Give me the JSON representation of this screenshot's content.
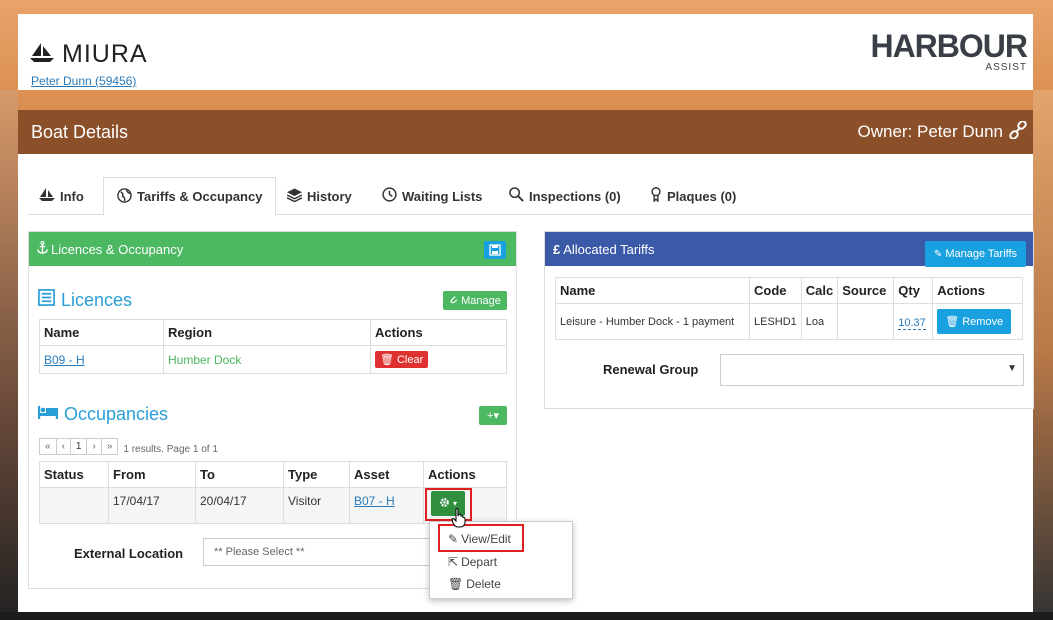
{
  "header": {
    "app_name": "MIURA",
    "user_link": "Peter Dunn (59456)",
    "brand": "HARBOUR",
    "brand_sub": "ASSIST"
  },
  "page": {
    "title": "Boat Details",
    "owner": "Owner: Peter Dunn"
  },
  "tabs": [
    {
      "label": "Info"
    },
    {
      "label": "Tariffs & Occupancy"
    },
    {
      "label": "History"
    },
    {
      "label": "Waiting Lists"
    },
    {
      "label": "Inspections (0)"
    },
    {
      "label": "Plaques (0)"
    }
  ],
  "licences_panel": {
    "title": "Licences & Occupancy",
    "licences_title": "Licences",
    "manage_label": "Manage",
    "columns": [
      "Name",
      "Region",
      "Actions"
    ],
    "rows": [
      {
        "name": "B09 - H",
        "region": "Humber Dock",
        "action": "Clear"
      }
    ],
    "occupancies_title": "Occupancies",
    "add_label": "+▾",
    "pager": {
      "first": "«",
      "prev": "‹",
      "page": "1",
      "next": "›",
      "last": "»",
      "summary": "1 results. Page 1 of 1"
    },
    "occ_columns": [
      "Status",
      "From",
      "To",
      "Type",
      "Asset",
      "Actions"
    ],
    "occ_rows": [
      {
        "status": "",
        "from": "17/04/17",
        "to": "20/04/17",
        "type": "Visitor",
        "asset": "B07 - H"
      }
    ],
    "external_location_label": "External Location",
    "external_location_placeholder": "** Please Select **"
  },
  "action_menu": {
    "items": [
      "View/Edit",
      "Depart",
      "Delete"
    ]
  },
  "tariffs_panel": {
    "title": "Allocated Tariffs",
    "manage_label": "Manage Tariffs",
    "columns": [
      "Name",
      "Code",
      "Calc",
      "Source",
      "Qty",
      "Actions"
    ],
    "rows": [
      {
        "name": "Leisure - Humber Dock - 1 payment",
        "code": "LESHD1",
        "calc": "Loa",
        "source": "",
        "qty": "10.37",
        "action": "Remove"
      }
    ],
    "renewal_label": "Renewal Group",
    "renewal_value": ""
  },
  "colors": {
    "title_bar": "#8b4f2a",
    "green": "#4cb962",
    "blue_header": "#3a5aa7",
    "accent_blue": "#19a0e0",
    "danger": "#e03131"
  }
}
